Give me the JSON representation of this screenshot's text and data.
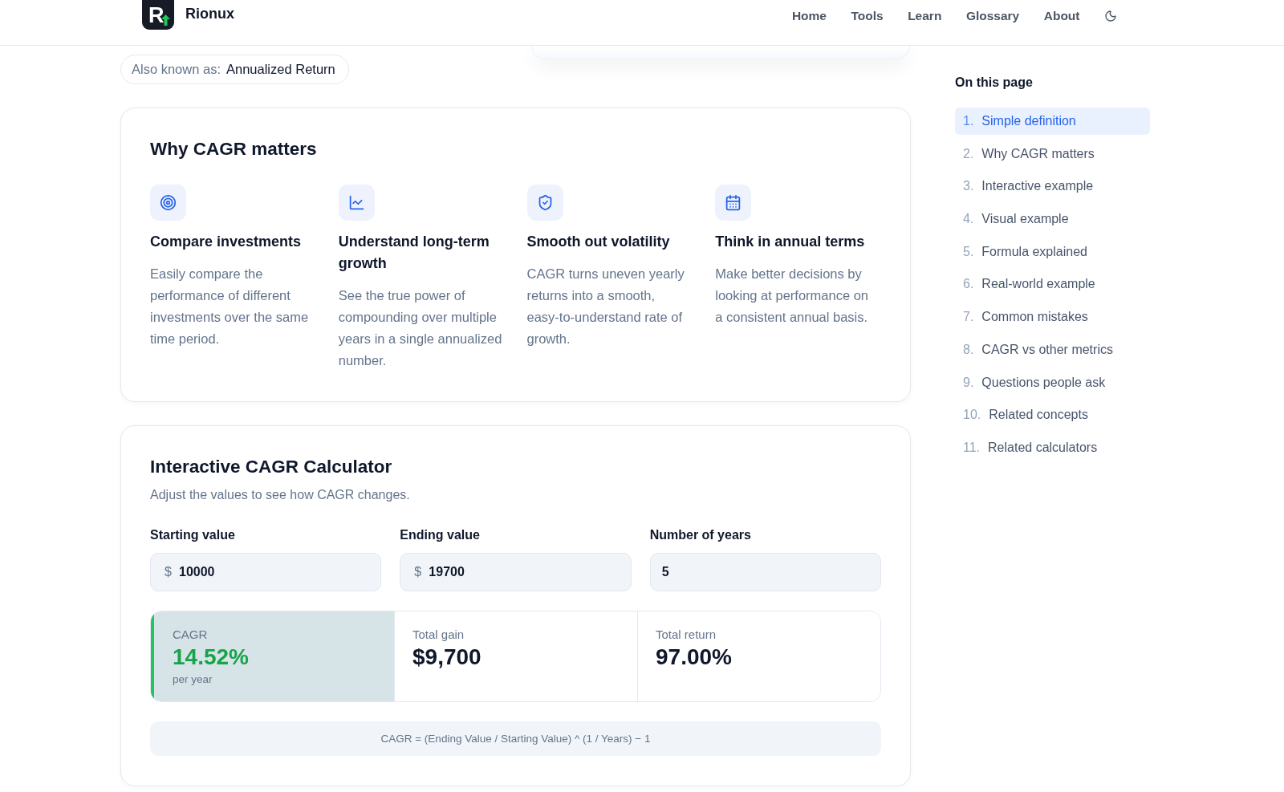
{
  "header": {
    "logo_letter": "R",
    "brand": "Rionux",
    "nav": [
      "Home",
      "Tools",
      "Learn",
      "Glossary",
      "About"
    ]
  },
  "alias": {
    "label": "Also known as:",
    "value": "Annualized Return"
  },
  "why_cagr": {
    "title": "Why CAGR matters",
    "features": [
      {
        "title": "Compare investments",
        "description": "Easily compare the performance of different investments over the same time period."
      },
      {
        "title": "Understand long-term growth",
        "description": "See the true power of compounding over multiple years in a single annualized number."
      },
      {
        "title": "Smooth out volatility",
        "description": "CAGR turns uneven yearly returns into a smooth, easy-to-understand rate of growth."
      },
      {
        "title": "Think in annual terms",
        "description": "Make better decisions by looking at performance on a consistent annual basis."
      }
    ]
  },
  "calculator": {
    "title": "Interactive CAGR Calculator",
    "subtitle": "Adjust the values to see how CAGR changes.",
    "fields": [
      {
        "label": "Starting value",
        "prefix": "$",
        "value": "10000"
      },
      {
        "label": "Ending value",
        "prefix": "$",
        "value": "19700"
      },
      {
        "label": "Number of years",
        "value": "5"
      }
    ],
    "results": [
      {
        "label": "CAGR",
        "value": "14.52%",
        "note": "per year",
        "highlighted": true
      },
      {
        "label": "Total gain",
        "value": "$9,700",
        "highlighted": false
      },
      {
        "label": "Total return",
        "value": "97.00%",
        "highlighted": false
      }
    ],
    "formula": "CAGR = (Ending Value / Starting Value) ^ (1 / Years) − 1"
  },
  "toc": {
    "title": "On this page",
    "items": [
      {
        "number": "1.",
        "label": "Simple definition",
        "selected": true
      },
      {
        "number": "2.",
        "label": "Why CAGR matters",
        "selected": false
      },
      {
        "number": "3.",
        "label": "Interactive example",
        "selected": false
      },
      {
        "number": "4.",
        "label": "Visual example",
        "selected": false
      },
      {
        "number": "5.",
        "label": "Formula explained",
        "selected": false
      },
      {
        "number": "6.",
        "label": "Real-world example",
        "selected": false
      },
      {
        "number": "7.",
        "label": "Common mistakes",
        "selected": false
      },
      {
        "number": "8.",
        "label": "CAGR vs other metrics",
        "selected": false
      },
      {
        "number": "9.",
        "label": "Questions people ask",
        "selected": false
      },
      {
        "number": "10.",
        "label": "Related concepts",
        "selected": false
      },
      {
        "number": "11.",
        "label": "Related calculators",
        "selected": false
      }
    ]
  }
}
